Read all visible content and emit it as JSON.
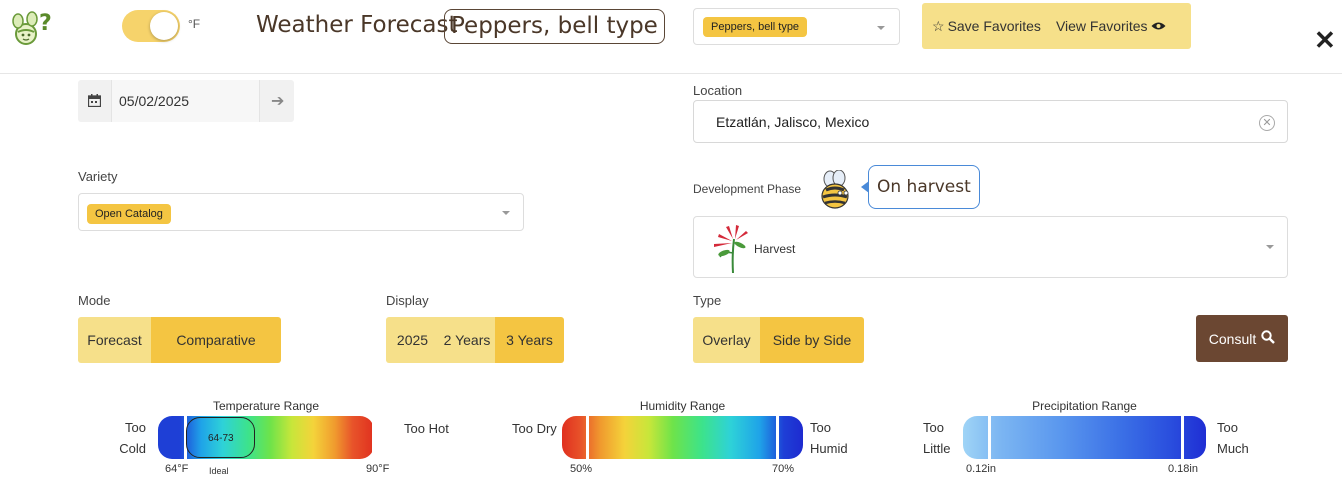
{
  "header": {
    "unit": "°F",
    "title": "Weather Forecast",
    "crop_chip": "Peppers, bell type",
    "crop_select_value": "Peppers, bell type",
    "save_favorites": "Save Favorites",
    "view_favorites": "View Favorites",
    "close": "✕"
  },
  "date": {
    "value": "05/02/2025"
  },
  "location": {
    "label": "Location",
    "value": "Etzatlán, Jalisco, Mexico"
  },
  "variety": {
    "label": "Variety",
    "value": "Open Catalog"
  },
  "phase": {
    "label": "Development Phase",
    "bubble": "On harvest",
    "value": "Harvest"
  },
  "mode": {
    "label": "Mode",
    "options": [
      "Forecast",
      "Comparative"
    ],
    "selected": "Comparative"
  },
  "display": {
    "label": "Display",
    "options": [
      "2025",
      "2 Years",
      "3 Years"
    ],
    "selected": "3 Years"
  },
  "type": {
    "label": "Type",
    "options": [
      "Overlay",
      "Side by Side"
    ],
    "selected": "Side by Side"
  },
  "consult": {
    "label": "Consult"
  },
  "ranges": {
    "temperature": {
      "title": "Temperature Range",
      "low_label": [
        "Too",
        "Cold"
      ],
      "high_label": "Too Hot",
      "min": "64°F",
      "max": "90°F",
      "ideal_range": "64-73",
      "ideal_label": "Ideal"
    },
    "humidity": {
      "title": "Humidity Range",
      "low_label": "Too Dry",
      "high_label": [
        "Too",
        "Humid"
      ],
      "min": "50%",
      "max": "70%"
    },
    "precipitation": {
      "title": "Precipitation Range",
      "low_label": [
        "Too",
        "Little"
      ],
      "high_label": [
        "Too",
        "Much"
      ],
      "min": "0.12in",
      "max": "0.18in"
    }
  },
  "colors": {
    "accent": "#f4c542",
    "accent_light": "#f6e08a",
    "consult": "#6b4732",
    "bubble_border": "#4a8ad8"
  }
}
